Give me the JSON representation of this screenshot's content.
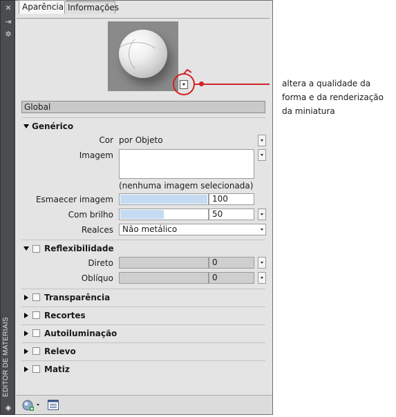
{
  "palette": {
    "title": "EDITOR DE MATERIAIS"
  },
  "tabs": [
    {
      "label": "Aparência"
    },
    {
      "label": "Informações"
    }
  ],
  "callout": {
    "text": "altera a qualidade da forma e da renderização da miniatura"
  },
  "global_label": "Global",
  "generic": {
    "title": "Genérico",
    "color_label": "Cor",
    "color_value": "por Objeto",
    "image_label": "Imagem",
    "image_note": "(nenhuma imagem selecionada)",
    "fade_label": "Esmaecer imagem",
    "fade_value": "100",
    "fade_level": 1.0,
    "gloss_label": "Com brilho",
    "gloss_value": "50",
    "gloss_level": 0.5,
    "highlights_label": "Realces",
    "highlights_value": "Não metálico"
  },
  "reflectivity": {
    "title": "Reflexibilidade",
    "direct_label": "Direto",
    "direct_value": "0",
    "oblique_label": "Oblíquo",
    "oblique_value": "0"
  },
  "sections": [
    {
      "label": "Transparência"
    },
    {
      "label": "Recortes"
    },
    {
      "label": "Autoiluminação"
    },
    {
      "label": "Relevo"
    },
    {
      "label": "Matiz"
    }
  ],
  "colors": {
    "accent_red": "#d2222a",
    "slider_fill": "#c5dbf1"
  }
}
